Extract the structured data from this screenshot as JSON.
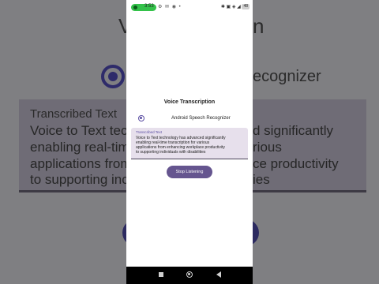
{
  "status_bar": {
    "time": "3:53",
    "left_icons": "⚙ ✉ ◉ •",
    "right_icons": "✱ ▣ ◈ ◢",
    "battery": "48"
  },
  "background": {
    "title_left": "Vo",
    "title_right": "n",
    "radio_label_fragment": "ecognizer",
    "caption": "Transcribed Text",
    "lines_left": [
      "Voice to Text tec",
      "enabling real-tim",
      "applications from",
      "to supporting inc"
    ],
    "lines_right": [
      "d significantly",
      "rious",
      "ce productivity",
      "ies"
    ]
  },
  "app": {
    "title": "Voice Transcription",
    "radio_option_label": "Android Speech Recognizer",
    "radio_selected": true,
    "text_field": {
      "label": "Transcribed Text",
      "lines": [
        "Voice to Text technology has advanced significantly",
        "enabling real-time transcription for various",
        "applications from enhancing workplace productivity",
        "to supporting individuals with disabilities"
      ]
    },
    "stop_button_label": "Stop Listening",
    "accent_color": "#65558f"
  },
  "navigation": {
    "icons": [
      "back-icon",
      "home-icon",
      "recents-icon"
    ]
  }
}
